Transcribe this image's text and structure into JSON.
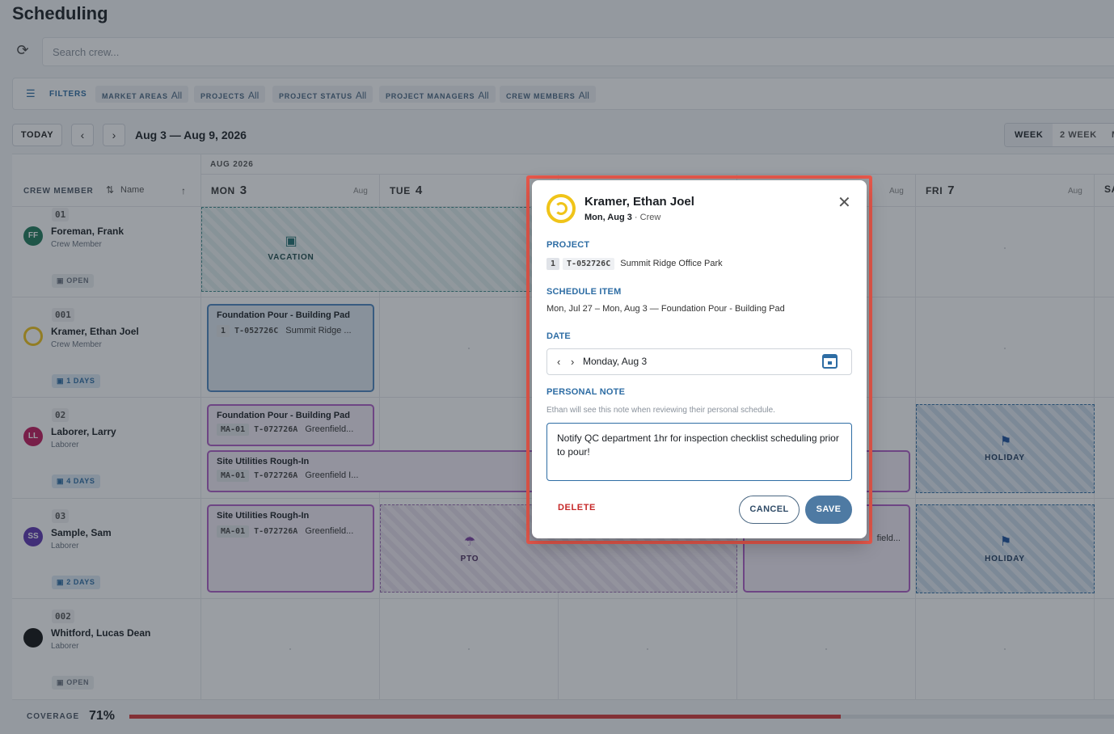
{
  "page": {
    "title": "Scheduling"
  },
  "search": {
    "placeholder": "Search crew..."
  },
  "filters": {
    "label": "FILTERS",
    "chips": [
      {
        "key": "MARKET AREAS",
        "value": "All"
      },
      {
        "key": "PROJECTS",
        "value": "All"
      },
      {
        "key": "PROJECT STATUS",
        "value": "All"
      },
      {
        "key": "PROJECT MANAGERS",
        "value": "All"
      },
      {
        "key": "CREW MEMBERS",
        "value": "All"
      }
    ]
  },
  "toolbar": {
    "today_label": "TODAY",
    "prev_glyph": "‹",
    "next_glyph": "›",
    "date_range": "Aug 3 — Aug 9, 2026",
    "views": [
      "WEEK",
      "2 WEEK",
      "M"
    ]
  },
  "grid": {
    "month_label": "AUG 2026",
    "crew_header": "CREW MEMBER",
    "sort_label": "Name",
    "days": [
      {
        "dow": "MON",
        "num": "3",
        "month": "Aug"
      },
      {
        "dow": "TUE",
        "num": "4",
        "month": ""
      },
      {
        "dow": "THU",
        "num": "",
        "month": "Aug"
      },
      {
        "dow": "FRI",
        "num": "7",
        "month": "Aug"
      },
      {
        "dow": "SA",
        "num": "",
        "month": ""
      }
    ],
    "crew": [
      {
        "code": "01",
        "initials": "FF",
        "name": "Foreman, Frank",
        "role": "Crew Member",
        "badge": "OPEN",
        "avatar_color": "#1f7a5a"
      },
      {
        "code": "001",
        "initials": "",
        "name": "Kramer, Ethan Joel",
        "role": "Crew Member",
        "badge": "1 DAYS",
        "avatar_color": "#f0c419"
      },
      {
        "code": "02",
        "initials": "LL",
        "name": "Laborer, Larry",
        "role": "Laborer",
        "badge": "4 DAYS",
        "avatar_color": "#c2185b"
      },
      {
        "code": "03",
        "initials": "SS",
        "name": "Sample, Sam",
        "role": "Laborer",
        "badge": "2 DAYS",
        "avatar_color": "#5e35b1"
      },
      {
        "code": "002",
        "initials": "",
        "name": "Whitford, Lucas Dean",
        "role": "Laborer",
        "badge": "OPEN",
        "avatar_color": "#111111"
      }
    ],
    "events": {
      "vacation": "VACATION",
      "pto": "PTO",
      "holiday": "HOLIDAY",
      "kramer_title": "Foundation Pour - Building Pad",
      "kramer_num": "1",
      "kramer_code": "T-052726C",
      "kramer_proj": "Summit Ridge ...",
      "larry1_title": "Foundation Pour - Building Pad",
      "larry1_ma": "MA-01",
      "larry1_code": "T-072726A",
      "larry1_proj": "Greenfield...",
      "larry2_title": "Site Utilities Rough-In",
      "larry2_ma": "MA-01",
      "larry2_code": "T-072726A",
      "larry2_proj": "Greenfield I...",
      "sam1_title": "Site Utilities Rough-In",
      "sam1_ma": "MA-01",
      "sam1_code": "T-072726A",
      "sam1_proj": "Greenfield...",
      "sam2_frag": "field..."
    }
  },
  "coverage": {
    "label": "COVERAGE",
    "value": "71%",
    "fraction": 0.71
  },
  "modal": {
    "name": "Kramer, Ethan Joel",
    "date_bold": "Mon, Aug 3",
    "sub_suffix": " · Crew",
    "project_label": "PROJECT",
    "project_num": "1",
    "project_code": "T-052726C",
    "project_name": "Summit Ridge Office Park",
    "schedule_label": "SCHEDULE ITEM",
    "schedule_value": "Mon, Jul 27 – Mon, Aug 3 — Foundation Pour - Building Pad",
    "date_label": "DATE",
    "date_value": "Monday, Aug 3",
    "note_label": "PERSONAL NOTE",
    "note_hint": "Ethan will see this note when reviewing their personal schedule.",
    "note_value": "Notify QC department 1hr for inspection checklist scheduling prior to pour!",
    "delete_label": "DELETE",
    "cancel_label": "CANCEL",
    "save_label": "SAVE"
  },
  "colors": {
    "accent": "#2e6da4",
    "danger": "#c62828",
    "highlight": "#e8584b"
  }
}
